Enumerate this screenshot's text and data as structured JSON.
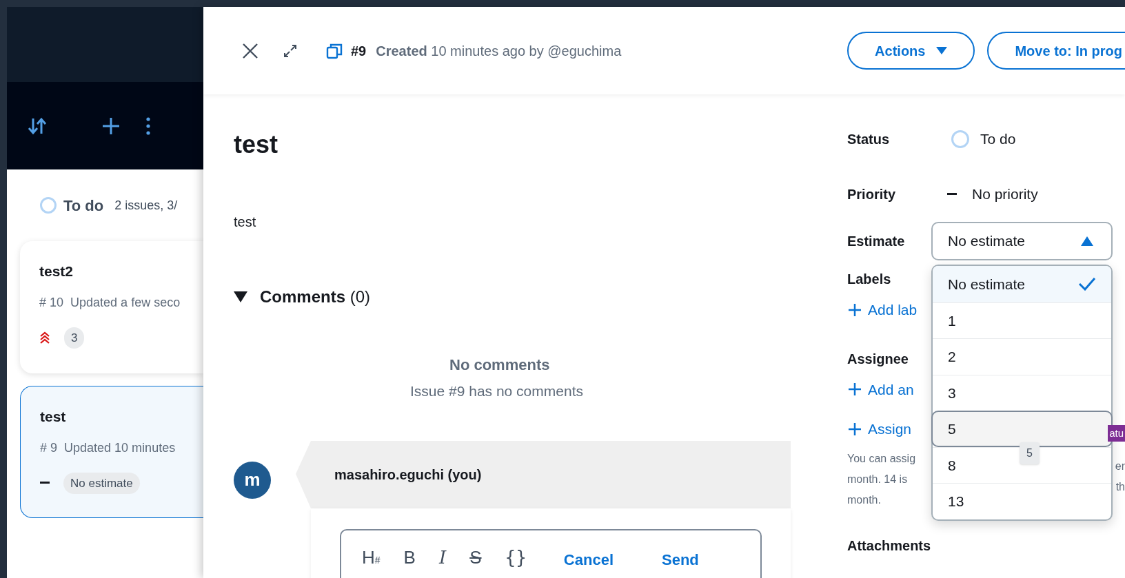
{
  "board": {
    "column": {
      "title": "To do",
      "summary": "2 issues, 3/"
    },
    "cards": [
      {
        "title": "test2",
        "number": "# 10",
        "meta": "Updated a few seco",
        "kind": "urgent",
        "badge": "3",
        "selected": false
      },
      {
        "title": "test",
        "number": "# 9",
        "meta": "Updated 10 minutes",
        "kind": "none",
        "badge": "No estimate",
        "selected": true
      }
    ]
  },
  "issue": {
    "number": "#9",
    "created_label": "Created",
    "created_text": "10 minutes ago by @eguchima",
    "header_buttons": [
      {
        "label": "Actions",
        "kind": "menu"
      },
      {
        "label": "Move to: In prog",
        "kind": "plain"
      }
    ],
    "title": "test",
    "description": "test",
    "comments": {
      "heading": "Comments",
      "count": "(0)",
      "expanded": true,
      "empty_title": "No comments",
      "empty_text": "Issue #9 has no comments",
      "author": "masahiro.eguchi (you)",
      "avatar": "m",
      "toolbar": [
        {
          "kind": "heading",
          "label": "H",
          "sub": "#"
        },
        {
          "kind": "bold",
          "label": "B"
        },
        {
          "kind": "italic",
          "label": "I"
        },
        {
          "kind": "strike",
          "label": "S"
        },
        {
          "kind": "code",
          "label": "{}"
        }
      ],
      "actions": [
        "Cancel",
        "Send"
      ]
    }
  },
  "fields": {
    "status": {
      "label": "Status",
      "value": "To do"
    },
    "priority": {
      "label": "Priority",
      "value": "No priority"
    },
    "estimate": {
      "label": "Estimate",
      "value": "No estimate",
      "expanded": true,
      "options": [
        {
          "label": "No estimate",
          "selected": true,
          "hovered": false
        },
        {
          "label": "1",
          "selected": false,
          "hovered": false
        },
        {
          "label": "2",
          "selected": false,
          "hovered": false
        },
        {
          "label": "3",
          "selected": false,
          "hovered": false
        },
        {
          "label": "5",
          "selected": false,
          "hovered": true
        },
        {
          "label": "8",
          "selected": false,
          "hovered": false
        },
        {
          "label": "13",
          "selected": false,
          "hovered": false
        }
      ],
      "tooltip": "5"
    },
    "labels": {
      "label": "Labels",
      "add": "Add lab"
    },
    "assignee": {
      "label": "Assignee",
      "add": "Add an",
      "assign": "Assign",
      "badge": "atu",
      "help_left": [
        "You can assig",
        "month. 14 is",
        "month."
      ],
      "help_right": [
        "er",
        "th"
      ]
    },
    "attachments": {
      "label": "Attachments"
    }
  }
}
